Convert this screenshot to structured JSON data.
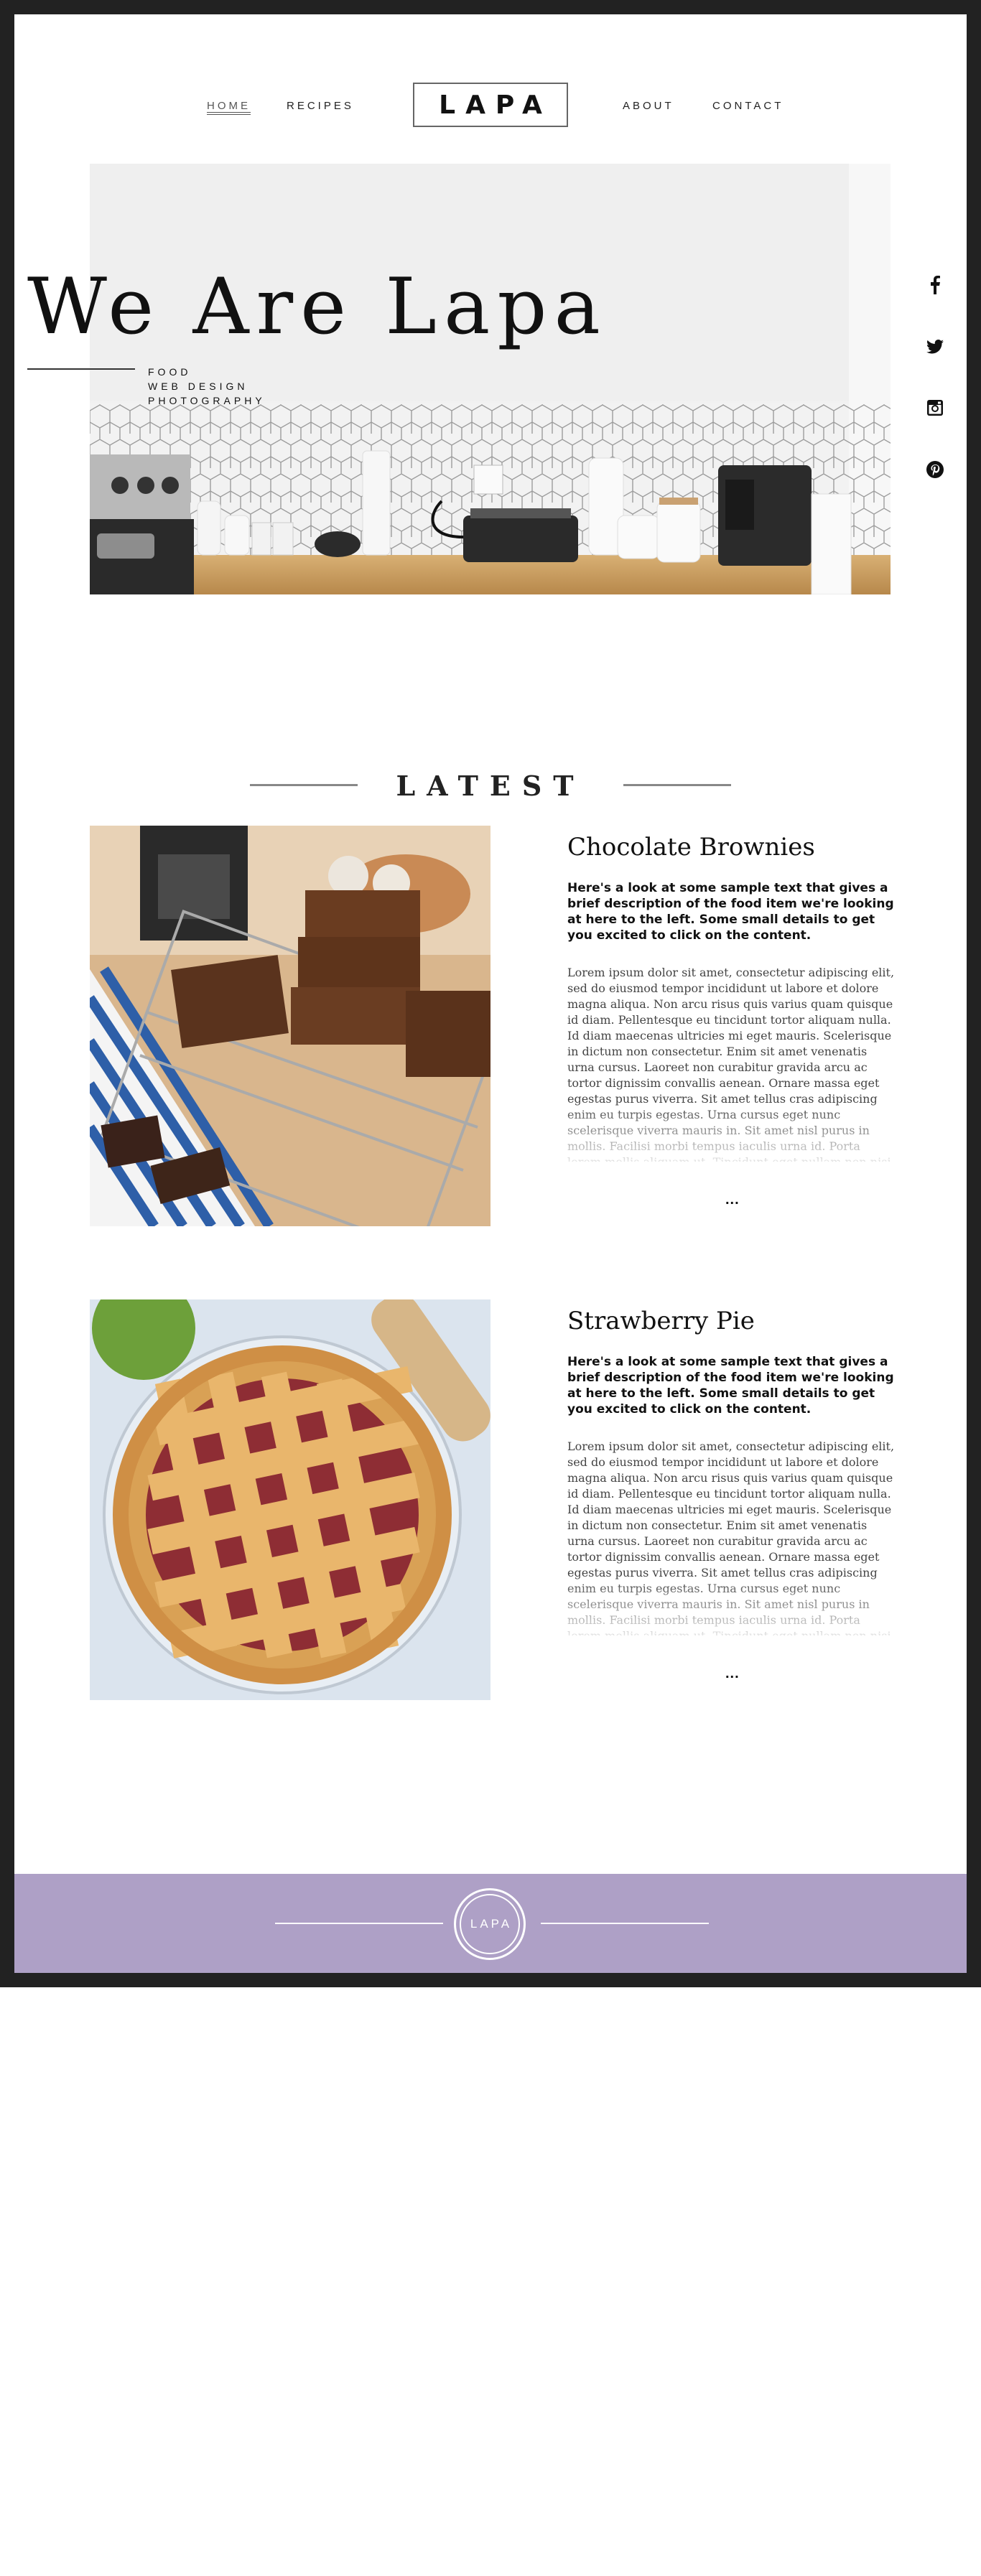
{
  "nav": {
    "left": [
      {
        "label": "HOME",
        "active": true
      },
      {
        "label": "RECIPES",
        "active": false
      }
    ],
    "logo": "LAPA",
    "right": [
      {
        "label": "ABOUT"
      },
      {
        "label": "CONTACT"
      }
    ]
  },
  "hero": {
    "title": "We Are Lapa",
    "taglines": [
      "FOOD",
      "WEB DESIGN",
      "PHOTOGRAPHY"
    ]
  },
  "social": [
    {
      "icon": "facebook-icon"
    },
    {
      "icon": "twitter-icon"
    },
    {
      "icon": "instagram-icon"
    },
    {
      "icon": "pinterest-icon"
    }
  ],
  "latest": {
    "title": "LATEST"
  },
  "posts": [
    {
      "title": "Chocolate Brownies",
      "intro": "Here's a look at some sample text that gives a brief description of the food item we're looking at here to the left. Some small details to get you excited to click on the content.",
      "body": "Lorem ipsum dolor sit amet, consectetur adipiscing elit, sed do eiusmod tempor incididunt ut labore et dolore magna aliqua. Non arcu risus quis varius quam quisque id diam. Pellentesque eu tincidunt tortor aliquam nulla. Id diam maecenas ultricies mi eget mauris. Scelerisque in dictum non consectetur. Enim sit amet venenatis urna cursus. Laoreet non curabitur gravida arcu ac tortor dignissim convallis aenean. Ornare massa eget egestas purus viverra. Sit amet tellus cras adipiscing enim eu turpis egestas. Urna cursus eget nunc scelerisque viverra mauris in. Sit amet nisl purus in mollis. Facilisi morbi tempus iaculis urna id. Porta lorem mollis aliquam ut. Tincidunt eget nullam non nisi. Odio pellentesque diam",
      "more": "..."
    },
    {
      "title": "Strawberry Pie",
      "intro": "Here's a look at some sample text that gives a brief description of the food item we're looking at here to the left. Some small details to get you excited to click on the content.",
      "body": "Lorem ipsum dolor sit amet, consectetur adipiscing elit, sed do eiusmod tempor incididunt ut labore et dolore magna aliqua. Non arcu risus quis varius quam quisque id diam. Pellentesque eu tincidunt tortor aliquam nulla. Id diam maecenas ultricies mi eget mauris. Scelerisque in dictum non consectetur. Enim sit amet venenatis urna cursus. Laoreet non curabitur gravida arcu ac tortor dignissim convallis aenean. Ornare massa eget egestas purus viverra. Sit amet tellus cras adipiscing enim eu turpis egestas. Urna cursus eget nunc scelerisque viverra mauris in. Sit amet nisl purus in mollis. Facilisi morbi tempus iaculis urna id. Porta lorem mollis aliquam ut. Tincidunt eget nullam non nisi. Odio pellentesque diam",
      "more": "..."
    }
  ],
  "footer": {
    "logo": "LAPA"
  },
  "colors": {
    "footer": "#aea0c6",
    "frame": "#222222",
    "accent": "#111111"
  }
}
